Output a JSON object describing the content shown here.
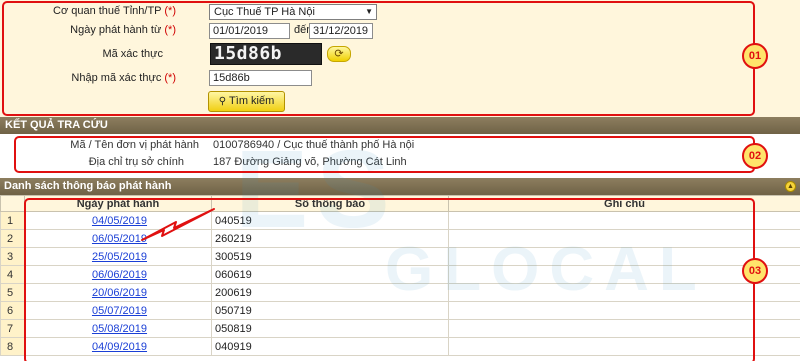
{
  "form": {
    "authority_label": "Cơ quan thuế Tỉnh/TP",
    "authority_required": "(*)",
    "authority_value": "Cục Thuế TP Hà Nội",
    "date_label": "Ngày phát hành từ",
    "date_required": "(*)",
    "date_from": "01/01/2019",
    "date_to_label": "đến",
    "date_to_required": "(*)",
    "date_to": "31/12/2019",
    "captcha_label": "Mã xác thực",
    "captcha_image_text": "15d86b",
    "captcha_input_label": "Nhập mã xác thực",
    "captcha_input_required": "(*)",
    "captcha_input_value": "15d86b",
    "search_label": "Tìm kiếm"
  },
  "annotations": {
    "first": "01",
    "second": "02",
    "third": "03"
  },
  "result": {
    "header": "KẾT QUẢ TRA CỨU",
    "id_label": "Mã / Tên đơn vị phát hành",
    "id_value": "0100786940 / Cục thuế thành phố Hà nội",
    "address_label": "Địa chỉ trụ sở chính",
    "address_value": "187 Đường Giảng võ, Phường Cát Linh"
  },
  "list": {
    "header": "Danh sách thông báo phát hành",
    "columns": [
      "Ngày phát hành",
      "Số thông báo",
      "Ghi chú"
    ],
    "rows": [
      {
        "no": "1",
        "date": "04/05/2019",
        "number": "040519",
        "note": ""
      },
      {
        "no": "2",
        "date": "06/05/2019",
        "number": "260219",
        "note": ""
      },
      {
        "no": "3",
        "date": "25/05/2019",
        "number": "300519",
        "note": ""
      },
      {
        "no": "4",
        "date": "06/06/2019",
        "number": "060619",
        "note": ""
      },
      {
        "no": "5",
        "date": "20/06/2019",
        "number": "200619",
        "note": ""
      },
      {
        "no": "6",
        "date": "05/07/2019",
        "number": "050719",
        "note": ""
      },
      {
        "no": "7",
        "date": "05/08/2019",
        "number": "050819",
        "note": ""
      },
      {
        "no": "8",
        "date": "04/09/2019",
        "number": "040919",
        "note": ""
      }
    ]
  },
  "watermark": {
    "line1": "ES",
    "line2": "GLOCAL"
  },
  "colors": {
    "form_bg": "#fff6dc",
    "bar_bg": "#7c6e52",
    "annotation": "#e01010",
    "link": "#1a3fd6",
    "button": "#f0cf12"
  }
}
